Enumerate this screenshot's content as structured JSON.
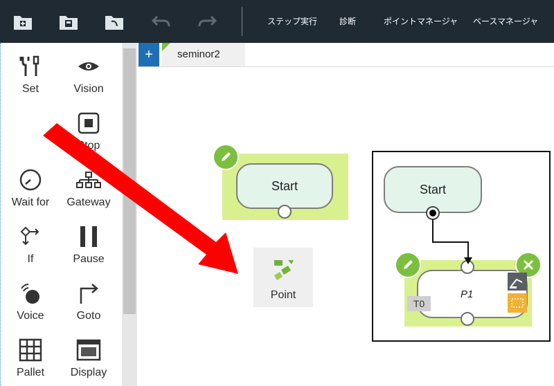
{
  "toolbar": {
    "step_run": "ステップ実行",
    "diagnosis": "診断",
    "point_manager": "ポイントマネージャ",
    "base_manager": "ベースマネージャ",
    "icons": [
      "new-folder-icon",
      "save-folder-icon",
      "open-folder-icon",
      "undo-icon",
      "redo-icon"
    ]
  },
  "palette": {
    "tools": [
      {
        "label": "Set",
        "icon": "wrench-screwdriver-icon"
      },
      {
        "label": "Vision",
        "icon": "eye-icon"
      },
      {
        "label": "Stop",
        "icon": "stop-icon"
      },
      {
        "label": "Wait for",
        "icon": "clock-icon"
      },
      {
        "label": "Gateway",
        "icon": "gateway-icon"
      },
      {
        "label": "If",
        "icon": "branch-icon"
      },
      {
        "label": "Pause",
        "icon": "pause-icon"
      },
      {
        "label": "Voice",
        "icon": "voice-icon"
      },
      {
        "label": "Goto",
        "icon": "goto-arrow-icon"
      },
      {
        "label": "Pallet",
        "icon": "grid-icon"
      },
      {
        "label": "Display",
        "icon": "display-icon"
      }
    ]
  },
  "tabs": {
    "add": "+",
    "active": "seminor2"
  },
  "canvas": {
    "start_label": "Start",
    "point_label": "Point",
    "inset_start_label": "Start",
    "p1_label": "P1",
    "t0_label": "T0"
  },
  "colors": {
    "accent_green": "#7bbf3e",
    "selection": "#d9f08f",
    "node_fill": "#e3f4ea",
    "arrow_red": "#ff0000",
    "toolbar_bg": "#1f2a33"
  }
}
